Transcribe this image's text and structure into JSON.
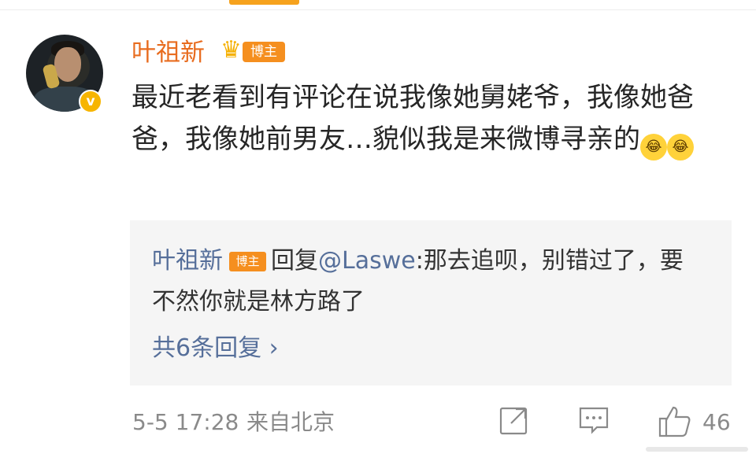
{
  "post": {
    "author": "叶祖新",
    "author_tag": "博主",
    "comment_text": "最近老看到有评论在说我像她舅姥爷，我像她爸爸，我像她前男友…貌似我是来微博寻亲的",
    "emoji_names": [
      "laugh-cry-emoji",
      "laugh-cry-emoji"
    ]
  },
  "reply": {
    "user": "叶祖新",
    "user_tag": "博主",
    "verb": "回复",
    "mention": "@Laswe",
    "text": ":那去追呗，别错过了，要不然你就是林方路了",
    "more_label": "共6条回复",
    "more_chevron": "›"
  },
  "footer": {
    "time": "5-5 17:28",
    "source": "来自北京",
    "likes": "46"
  },
  "colors": {
    "username": "#e86c1f",
    "badge": "#f58f1f",
    "link": "#566f9a",
    "meta": "#8a8a8a"
  }
}
